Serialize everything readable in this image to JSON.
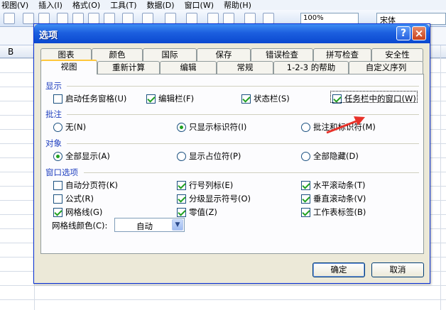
{
  "menubar": {
    "items": [
      "视图(V)",
      "插入(I)",
      "格式(O)",
      "工具(T)",
      "数据(D)",
      "窗口(W)",
      "帮助(H)"
    ]
  },
  "toolbar": {
    "zoom": "100%",
    "font": "宋体"
  },
  "sheet": {
    "column_label": "B"
  },
  "dialog": {
    "title": "选项",
    "help_button": "?",
    "close_button": "×",
    "tabs_row1": [
      "图表",
      "颜色",
      "国际",
      "保存",
      "错误检查",
      "拼写检查",
      "安全性"
    ],
    "tabs_row2": [
      "视图",
      "重新计算",
      "编辑",
      "常规",
      "1-2-3 的帮助",
      "自定义序列"
    ],
    "active_tab": "视图",
    "show": {
      "label": "显示",
      "startup_task_pane": {
        "label": "启动任务窗格(U)",
        "checked": false
      },
      "formula_bar": {
        "label": "编辑栏(F)",
        "checked": true
      },
      "status_bar": {
        "label": "状态栏(S)",
        "checked": true
      },
      "windows_in_taskbar": {
        "label": "任务栏中的窗口(W)",
        "checked": true
      }
    },
    "comments": {
      "label": "批注",
      "none": {
        "label": "无(N)",
        "selected": false
      },
      "indicator_only": {
        "label": "只显示标识符(I)",
        "selected": true
      },
      "comment_and_indicator": {
        "label": "批注和标识符(M)",
        "selected": false
      }
    },
    "objects": {
      "label": "对象",
      "show_all": {
        "label": "全部显示(A)",
        "selected": true
      },
      "show_placeholders": {
        "label": "显示占位符(P)",
        "selected": false
      },
      "hide_all": {
        "label": "全部隐藏(D)",
        "selected": false
      }
    },
    "window_options": {
      "label": "窗口选项",
      "page_breaks": {
        "label": "自动分页符(K)",
        "checked": false
      },
      "formulas": {
        "label": "公式(R)",
        "checked": false
      },
      "gridlines": {
        "label": "网格线(G)",
        "checked": true
      },
      "row_col_headers": {
        "label": "行号列标(E)",
        "checked": true
      },
      "outline_symbols": {
        "label": "分级显示符号(O)",
        "checked": true
      },
      "zero_values": {
        "label": "零值(Z)",
        "checked": true
      },
      "horizontal_scroll": {
        "label": "水平滚动条(T)",
        "checked": true
      },
      "vertical_scroll": {
        "label": "垂直滚动条(V)",
        "checked": true
      },
      "sheet_tabs": {
        "label": "工作表标签(B)",
        "checked": true
      },
      "gridline_color_label": "网格线颜色(C):",
      "gridline_color_value": "自动"
    },
    "ok_label": "确定",
    "cancel_label": "取消"
  },
  "colors": {
    "titlebar": "#0a48d0",
    "annotation_arrow": "#e8322a",
    "checkmark": "#21a121"
  }
}
